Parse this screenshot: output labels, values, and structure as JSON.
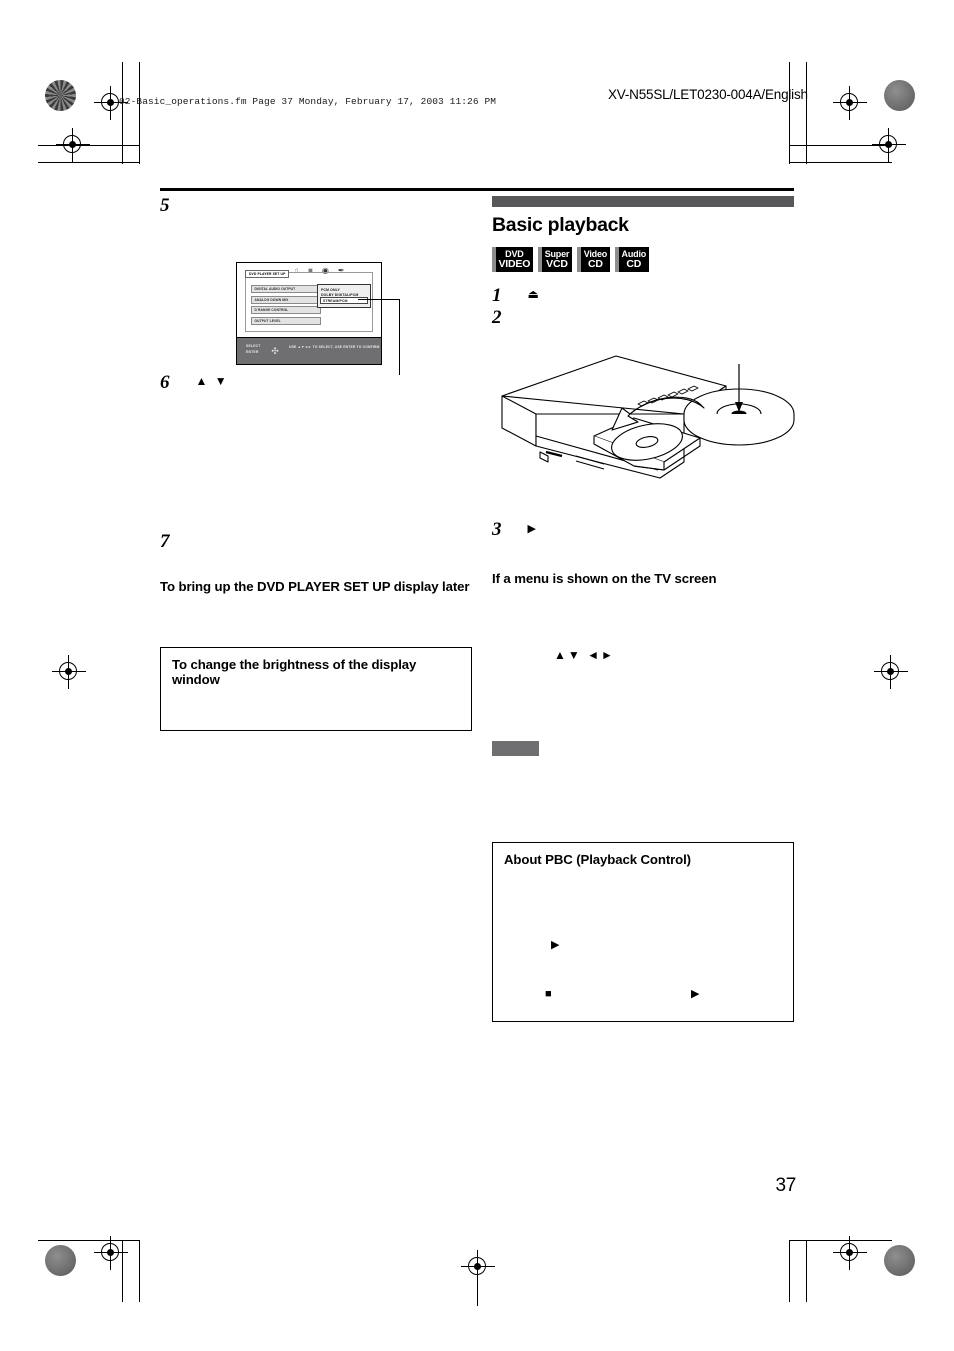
{
  "header": {
    "fm_line": "02-Basic_operations.fm  Page 37  Monday, February 17, 2003  11:26 PM",
    "doc_code": "XV-N55SL/LET0230-004A/English"
  },
  "left_column": {
    "steps": [
      {
        "number": "5",
        "text": ""
      },
      {
        "number": "6",
        "glyph": "▲ ▼",
        "text": ""
      },
      {
        "number": "7",
        "text": ""
      }
    ],
    "headings": [
      "To bring up the DVD PLAYER SET UP display later"
    ],
    "note_box": {
      "title": "To change the brightness of the display window",
      "body": ""
    }
  },
  "osd": {
    "title": "DVD PLAYER SET UP",
    "tab_icons": [
      "speaker-icon",
      "monitor-icon",
      "globe-icon",
      "pencil-icon"
    ],
    "menu_items": [
      "DIGITAL AUDIO OUTPUT",
      "ANALOG DOWN MIX",
      "D RANGE CONTROL",
      "OUTPUT LEVEL"
    ],
    "submenu_items": [
      "PCM ONLY",
      "DOLBY DIGITAL/PCM",
      "STREAM/PCM"
    ],
    "submenu_selected": "STREAM/PCM",
    "footer_left_line1": "SELECT",
    "footer_left_line2": "ENTER",
    "footer_right": "USE ▲▼◄► TO SELECT, USE ENTER TO CONFIRM"
  },
  "right_column": {
    "section_title": "Basic playback",
    "badges": [
      {
        "line1": "DVD",
        "line2": "VIDEO"
      },
      {
        "line1": "Super",
        "line2": "VCD"
      },
      {
        "line1": "Video",
        "line2": "CD"
      },
      {
        "line1": "Audio",
        "line2": "CD"
      }
    ],
    "steps": [
      {
        "number": "1",
        "glyph": "⏏",
        "text": ""
      },
      {
        "number": "2",
        "text": ""
      },
      {
        "number": "3",
        "glyph": "▶",
        "text": ""
      }
    ],
    "headings": [
      "If a menu is shown on the TV screen"
    ],
    "arrow_glyphs": "▲▼ ◄►",
    "gray_label": "",
    "pbc_box": {
      "title": "About PBC (Playback Control)",
      "body": "",
      "glyph_play_1": "▶",
      "glyph_stop": "■",
      "glyph_play_2": "▶"
    }
  },
  "footer": {
    "page_number": "37"
  },
  "colors": {
    "section_bar": "#58585a",
    "gray_label": "#6f6f71",
    "osd_footer": "#6f6f71",
    "badge_spine": "#8d8d8d"
  }
}
